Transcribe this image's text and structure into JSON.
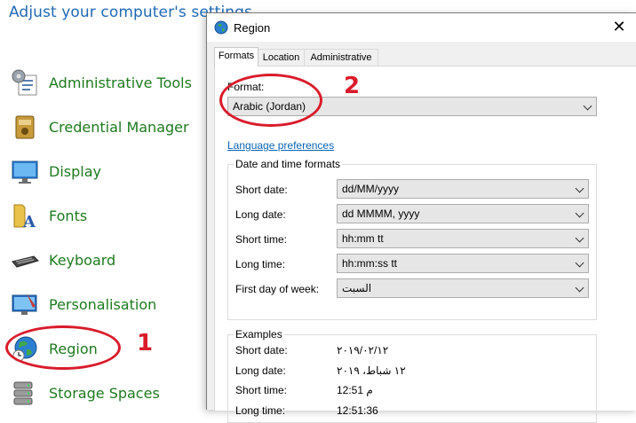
{
  "control_panel": {
    "title": "Adjust your computer's settings",
    "items": [
      {
        "label": "Administrative Tools",
        "icon": "admin-tools-icon"
      },
      {
        "label": "Credential Manager",
        "icon": "credential-manager-icon"
      },
      {
        "label": "Display",
        "icon": "display-icon"
      },
      {
        "label": "Fonts",
        "icon": "fonts-icon"
      },
      {
        "label": "Keyboard",
        "icon": "keyboard-icon"
      },
      {
        "label": "Personalisation",
        "icon": "personalisation-icon"
      },
      {
        "label": "Region",
        "icon": "region-globe-icon"
      },
      {
        "label": "Storage Spaces",
        "icon": "storage-spaces-icon"
      }
    ]
  },
  "annotations": {
    "step1": "1",
    "step2": "2",
    "color": "#d91c2b"
  },
  "dialog": {
    "title": "Region",
    "close_glyph": "✕",
    "tabs": [
      {
        "label": "Formats",
        "active": true
      },
      {
        "label": "Location",
        "active": false
      },
      {
        "label": "Administrative",
        "active": false
      }
    ],
    "format_label": "Format:",
    "format_value": "Arabic (Jordan)",
    "language_link": "Language preferences",
    "date_time_group": {
      "title": "Date and time formats",
      "rows": [
        {
          "label": "Short date:",
          "value": "dd/MM/yyyy"
        },
        {
          "label": "Long date:",
          "value": "dd MMMM, yyyy"
        },
        {
          "label": "Short time:",
          "value": "hh:mm tt"
        },
        {
          "label": "Long time:",
          "value": "hh:mm:ss tt"
        },
        {
          "label": "First day of week:",
          "value": "السبت"
        }
      ]
    },
    "examples_group": {
      "title": "Examples",
      "rows": [
        {
          "label": "Short date:",
          "value": "٢٠١٩/٠٢/١٢"
        },
        {
          "label": "Long date:",
          "value": "١٢ شباط، ٢٠١٩"
        },
        {
          "label": "Short time:",
          "value": "12:51 م"
        },
        {
          "label": "Long time:",
          "value": "12:51:36"
        }
      ]
    }
  }
}
